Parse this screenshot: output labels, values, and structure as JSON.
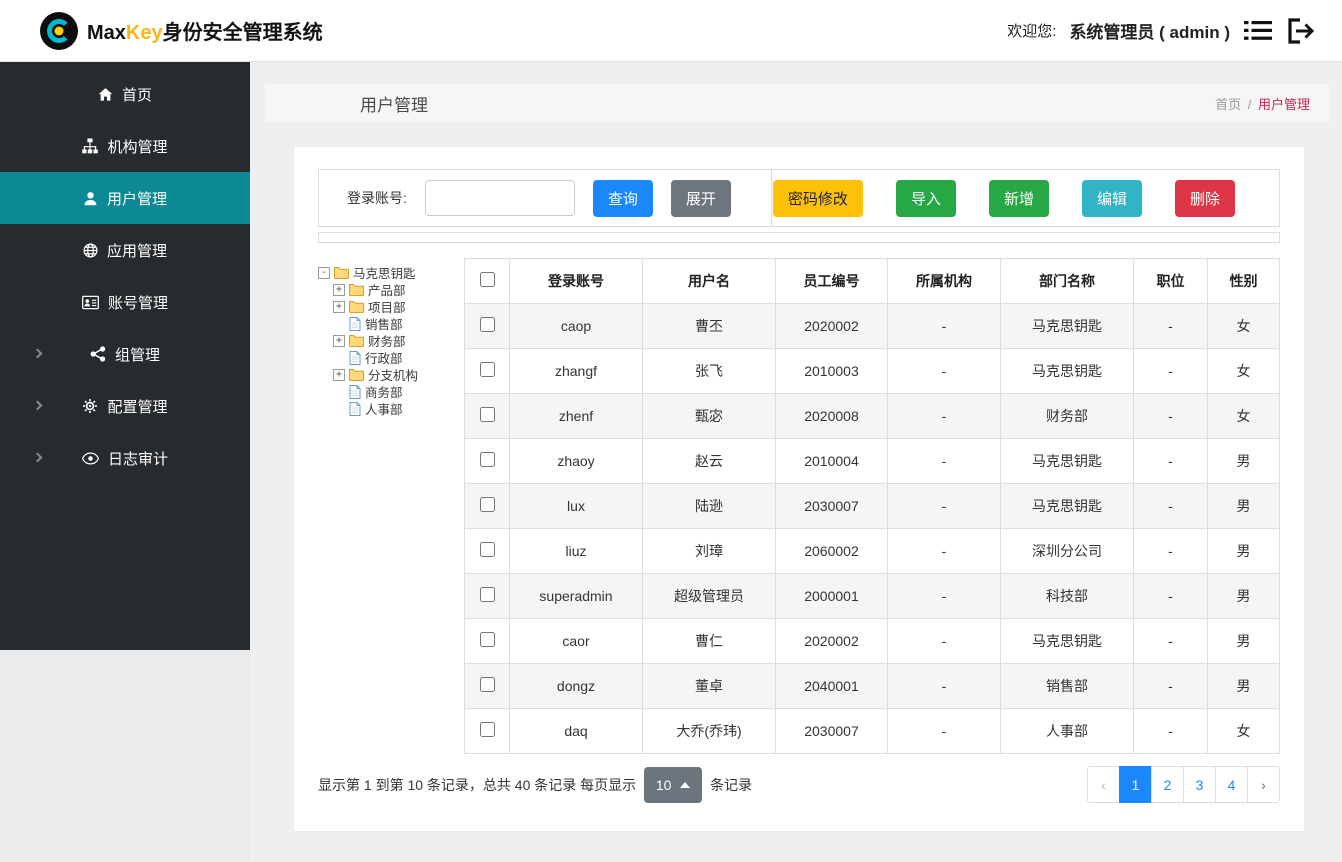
{
  "colors": {
    "primary": "#1a88fb",
    "menu_active": "#0c8994",
    "breadcrumb_active": "#c7254e",
    "pagesize": "#6c757d"
  },
  "header": {
    "brand_max": "Max",
    "brand_key": "Key",
    "brand_suffix": "身份安全管理系统",
    "welcome": "欢迎您:",
    "user": "系统管理员 ( admin )"
  },
  "sidebar": {
    "items": [
      {
        "id": "home",
        "label": "首页",
        "icon": "home"
      },
      {
        "id": "org",
        "label": "机构管理",
        "icon": "sitemap"
      },
      {
        "id": "user",
        "label": "用户管理",
        "icon": "user",
        "active": true
      },
      {
        "id": "app",
        "label": "应用管理",
        "icon": "globe"
      },
      {
        "id": "account",
        "label": "账号管理",
        "icon": "idcard"
      },
      {
        "id": "group",
        "label": "组管理",
        "icon": "group",
        "expandable": true
      },
      {
        "id": "config",
        "label": "配置管理",
        "icon": "gears",
        "expandable": true
      },
      {
        "id": "audit",
        "label": "日志审计",
        "icon": "eye",
        "expandable": true
      }
    ]
  },
  "page": {
    "title": "用户管理",
    "breadcrumb_home": "首页",
    "breadcrumb_sep": "/",
    "breadcrumb_current": "用户管理"
  },
  "toolbar": {
    "search_label": "登录账号:",
    "search_value": "",
    "query_button": "查询",
    "expand_button": "展开",
    "actions": [
      {
        "name": "password-modify-button",
        "label": "密码修改",
        "bg": "#ffc107",
        "fg": "#212529"
      },
      {
        "name": "import-button",
        "label": "导入",
        "bg": "#28a745",
        "fg": "#ffffff"
      },
      {
        "name": "add-button",
        "label": "新增",
        "bg": "#28a745",
        "fg": "#ffffff"
      },
      {
        "name": "edit-button",
        "label": "编辑",
        "bg": "#30b4c6",
        "fg": "#ffffff"
      },
      {
        "name": "delete-button",
        "label": "删除",
        "bg": "#dc3545",
        "fg": "#ffffff"
      }
    ]
  },
  "tree": {
    "root": "马克思钥匙",
    "collapse_glyph": "-",
    "expand_glyph": "+",
    "nodes": [
      {
        "label": "产品部",
        "type": "folder",
        "expandable": true
      },
      {
        "label": "项目部",
        "type": "folder",
        "expandable": true
      },
      {
        "label": "销售部",
        "type": "file"
      },
      {
        "label": "财务部",
        "type": "folder",
        "expandable": true
      },
      {
        "label": "行政部",
        "type": "file"
      },
      {
        "label": "分支机构",
        "type": "folder",
        "expandable": true
      },
      {
        "label": "商务部",
        "type": "file"
      },
      {
        "label": "人事部",
        "type": "file"
      }
    ]
  },
  "table": {
    "columns": [
      "登录账号",
      "用户名",
      "员工编号",
      "所属机构",
      "部门名称",
      "职位",
      "性别"
    ],
    "rows": [
      [
        "caop",
        "曹丕",
        "2020002",
        "-",
        "马克思钥匙",
        "-",
        "女"
      ],
      [
        "zhangf",
        "张飞",
        "2010003",
        "-",
        "马克思钥匙",
        "-",
        "女"
      ],
      [
        "zhenf",
        "甄宓",
        "2020008",
        "-",
        "财务部",
        "-",
        "女"
      ],
      [
        "zhaoy",
        "赵云",
        "2010004",
        "-",
        "马克思钥匙",
        "-",
        "男"
      ],
      [
        "lux",
        "陆逊",
        "2030007",
        "-",
        "马克思钥匙",
        "-",
        "男"
      ],
      [
        "liuz",
        "刘璋",
        "2060002",
        "-",
        "深圳分公司",
        "-",
        "男"
      ],
      [
        "superadmin",
        "超级管理员",
        "2000001",
        "-",
        "科技部",
        "-",
        "男"
      ],
      [
        "caor",
        "曹仁",
        "2020002",
        "-",
        "马克思钥匙",
        "-",
        "男"
      ],
      [
        "dongz",
        "董卓",
        "2040001",
        "-",
        "销售部",
        "-",
        "男"
      ],
      [
        "daq",
        "大乔(乔玮)",
        "2030007",
        "-",
        "人事部",
        "-",
        "女"
      ]
    ]
  },
  "footer": {
    "summary_prefix": "显示第 1 到第 10 条记录，总共 40 条记录 每页显示",
    "page_size": "10",
    "summary_suffix": "条记录",
    "pages": [
      "‹",
      "1",
      "2",
      "3",
      "4",
      "›"
    ],
    "active_page": "1",
    "prev_glyph": "‹",
    "next_glyph": "›"
  }
}
